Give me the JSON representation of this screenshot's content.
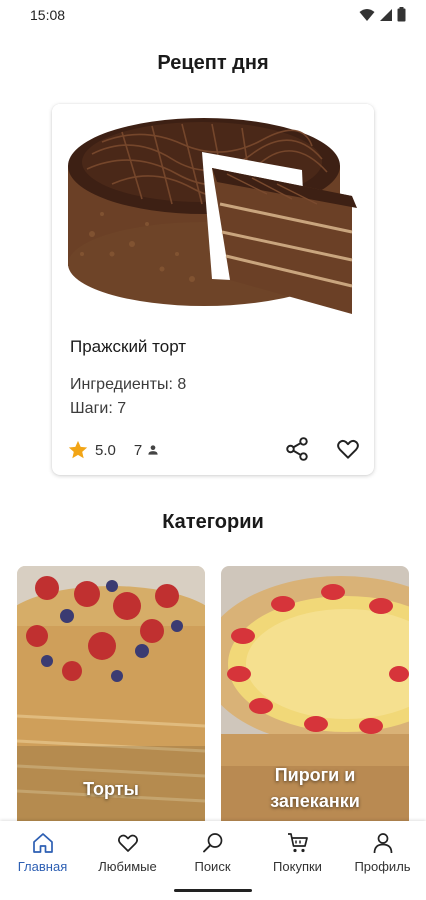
{
  "status_bar": {
    "time": "15:08",
    "icons": [
      "wifi-icon",
      "signal-icon",
      "battery-icon"
    ]
  },
  "recipe_of_day": {
    "title": "Рецепт  дня",
    "name": "Пражский торт",
    "ingredients": "Ингредиенты: 8",
    "steps": "Шаги: 7",
    "rating": "5.0",
    "people": "7"
  },
  "categories": {
    "title": "Категории",
    "items": [
      {
        "label": "Торты"
      },
      {
        "label_line1": "Пироги  и",
        "label_line2": "запеканки"
      }
    ]
  },
  "bottom_nav": {
    "items": [
      {
        "label": "Главная",
        "icon": "home-icon",
        "active": true
      },
      {
        "label": "Любимые",
        "icon": "heart-icon",
        "active": false
      },
      {
        "label": "Поиск",
        "icon": "search-icon",
        "active": false
      },
      {
        "label": "Покупки",
        "icon": "cart-icon",
        "active": false
      },
      {
        "label": "Профиль",
        "icon": "profile-icon",
        "active": false
      }
    ]
  },
  "colors": {
    "accent": "#2d5fb3",
    "star": "#f2a516",
    "text": "#1c1c1c"
  }
}
